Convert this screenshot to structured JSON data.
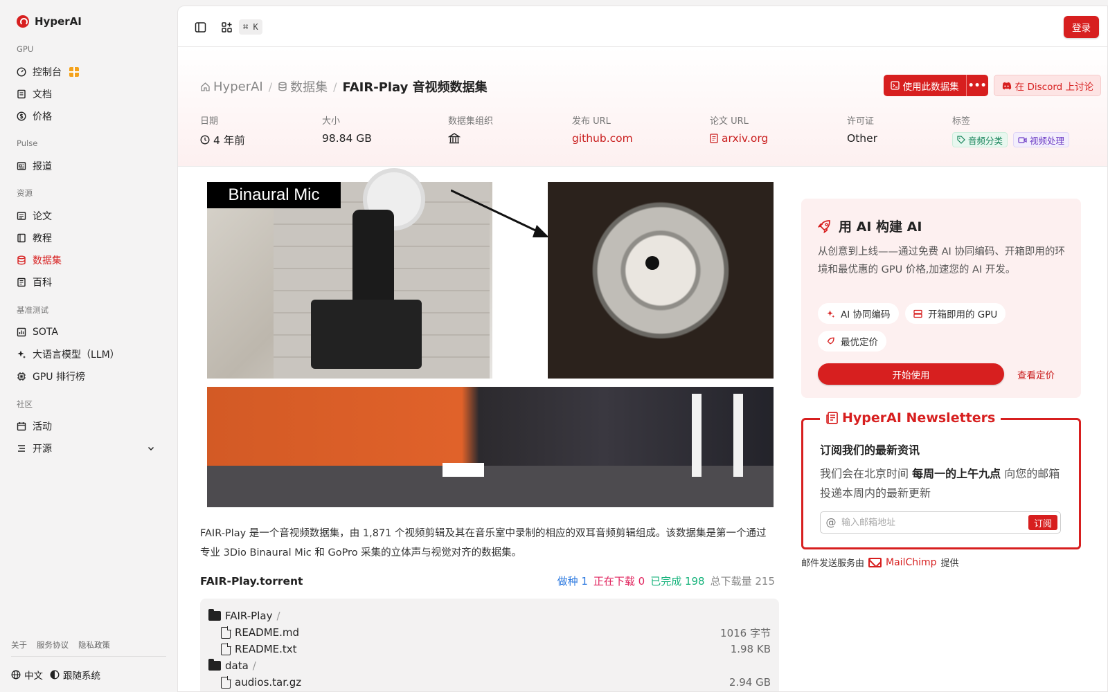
{
  "brand": {
    "name": "HyperAI"
  },
  "sidebar": {
    "sections": [
      {
        "label": "GPU",
        "items": [
          {
            "label": "控制台",
            "icon": "gauge-icon"
          },
          {
            "label": "文档",
            "icon": "doc-icon"
          },
          {
            "label": "价格",
            "icon": "dollar-icon"
          }
        ]
      },
      {
        "label": "Pulse",
        "items": [
          {
            "label": "报道",
            "icon": "newspaper-icon"
          }
        ]
      },
      {
        "label": "资源",
        "items": [
          {
            "label": "论文",
            "icon": "paper-icon"
          },
          {
            "label": "教程",
            "icon": "book-icon"
          },
          {
            "label": "数据集",
            "icon": "database-icon",
            "active": true
          },
          {
            "label": "百科",
            "icon": "wiki-icon"
          }
        ]
      },
      {
        "label": "基准测试",
        "items": [
          {
            "label": "SOTA",
            "icon": "chart-icon"
          },
          {
            "label": "大语言模型（LLM）",
            "icon": "sparkle-icon"
          },
          {
            "label": "GPU 排行榜",
            "icon": "chip-icon"
          }
        ]
      },
      {
        "label": "社区",
        "items": [
          {
            "label": "活动",
            "icon": "calendar-icon"
          },
          {
            "label": "开源",
            "icon": "list-icon"
          }
        ]
      }
    ],
    "footer_links": [
      "关于",
      "服务协议",
      "隐私政策"
    ],
    "language": "中文",
    "theme": "跟随系统"
  },
  "topbar": {
    "shortcut": "⌘ K",
    "login": "登录"
  },
  "breadcrumb": {
    "home": "HyperAI",
    "section": "数据集",
    "current": "FAIR-Play 音视频数据集"
  },
  "actions": {
    "use": "使用此数据集",
    "more": "•••",
    "discord": "在 Discord 上讨论"
  },
  "meta": {
    "date": {
      "key": "日期",
      "value": "4 年前"
    },
    "size": {
      "key": "大小",
      "value": "98.84 GB"
    },
    "org": {
      "key": "数据集组织"
    },
    "release_url": {
      "key": "发布 URL",
      "value": "github.com"
    },
    "paper_url": {
      "key": "论文 URL",
      "value": "arxiv.org"
    },
    "license": {
      "key": "许可证",
      "value": "Other"
    },
    "tags": {
      "key": "标签",
      "items": [
        "音频分类",
        "视频处理"
      ]
    }
  },
  "figure": {
    "caption": "Binaural Mic"
  },
  "description": "FAIR-Play 是一个音视频数据集，由 1,871 个视频剪辑及其在音乐室中录制的相应的双耳音频剪辑组成。该数据集是第一个通过专业 3Dio Binaural Mic 和 GoPro 采集的立体声与视觉对齐的数据集。",
  "torrent": {
    "title": "FAIR-Play.torrent",
    "seeding": "做种 1",
    "downloading": "正在下载 0",
    "completed": "已完成 198",
    "total": "总下载量 215",
    "files": [
      {
        "name": "FAIR-Play",
        "type": "folder",
        "size": ""
      },
      {
        "name": "README.md",
        "type": "file",
        "size": "1016 字节"
      },
      {
        "name": "README.txt",
        "type": "file",
        "size": "1.98 KB"
      },
      {
        "name": "data",
        "type": "folder",
        "size": ""
      },
      {
        "name": "audios.tar.gz",
        "type": "file",
        "size": "2.94 GB"
      }
    ]
  },
  "promo": {
    "title": "用 AI 构建 AI",
    "text": "从创意到上线——通过免费 AI 协同编码、开箱即用的环境和最优惠的 GPU 价格,加速您的 AI 开发。",
    "pills": [
      "AI 协同编码",
      "开箱即用的 GPU",
      "最优定价"
    ],
    "start": "开始使用",
    "pricing": "查看定价"
  },
  "newsletter": {
    "title": "HyperAI Newsletters",
    "subtitle": "订阅我们的最新资讯",
    "text_before": "我们会在北京时间 ",
    "text_bold": "每周一的上午九点",
    "text_after": " 向您的邮箱投递本周内的最新更新",
    "placeholder": "输入邮箱地址",
    "subscribe": "订阅",
    "credit_prefix": "邮件发送服务由",
    "credit_brand": "MailChimp",
    "credit_suffix": "提供"
  },
  "colors": {
    "accent": "#d71f1f",
    "seed": "#2f7be0",
    "downloading": "#e0245e",
    "done": "#14b27a"
  }
}
